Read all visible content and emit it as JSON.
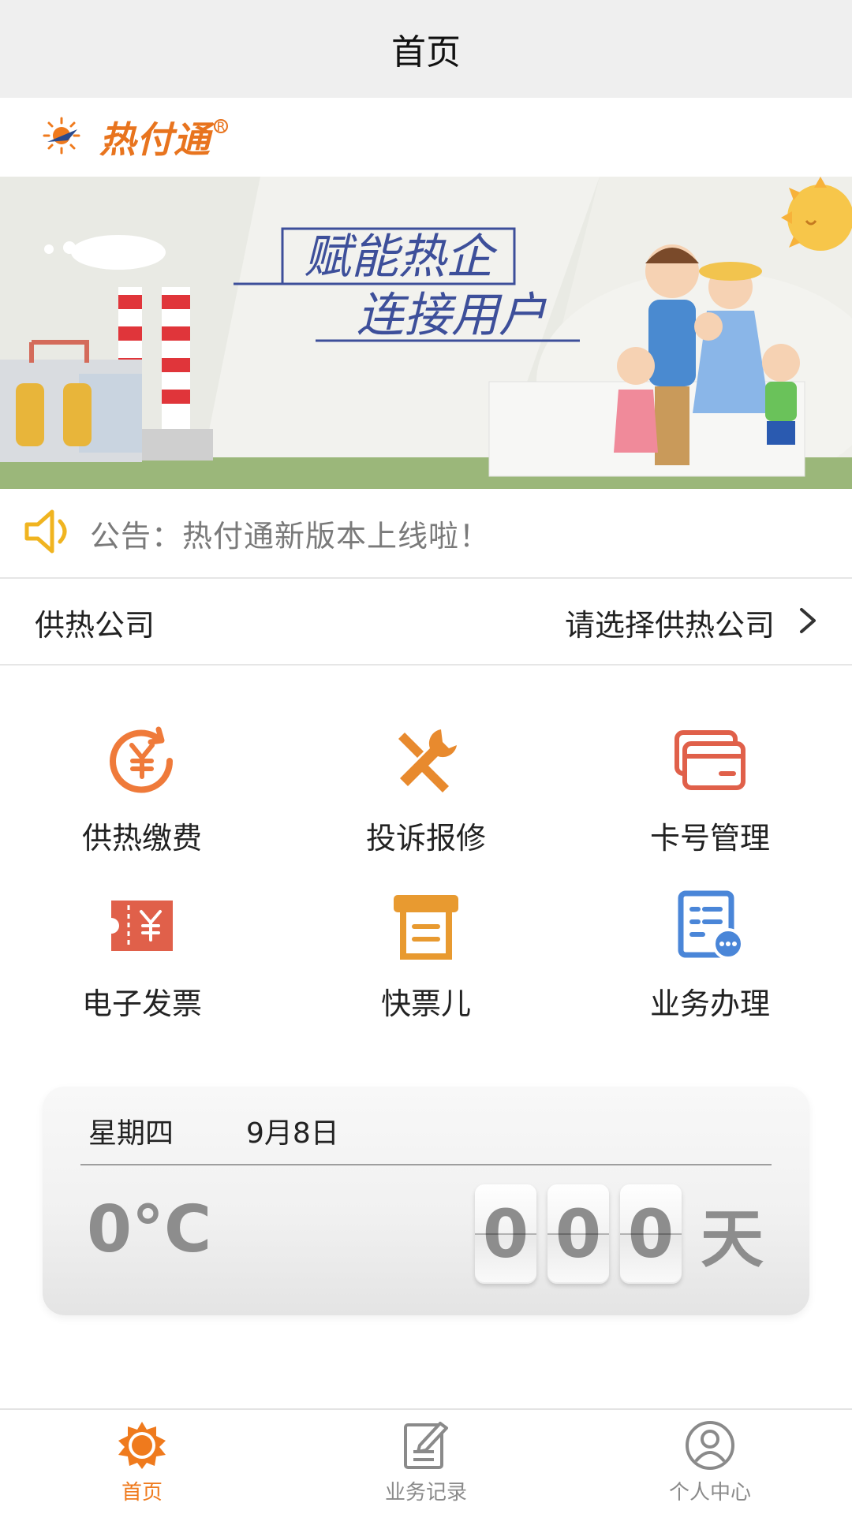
{
  "nav": {
    "title": "首页"
  },
  "logo": {
    "name": "热付通"
  },
  "banner": {
    "slogan_line1": "赋能热企",
    "slogan_line2": "连接用户"
  },
  "notice": {
    "text": "公告：热付通新版本上线啦！"
  },
  "company": {
    "label": "供热公司",
    "placeholder": "请选择供热公司"
  },
  "services": [
    {
      "label": "供热缴费",
      "icon": "yuan-refresh-icon",
      "color": "#ef7a3a"
    },
    {
      "label": "投诉报修",
      "icon": "wrench-screwdriver-icon",
      "color": "#e88a2e"
    },
    {
      "label": "卡号管理",
      "icon": "card-icon",
      "color": "#e0604a"
    },
    {
      "label": "电子发票",
      "icon": "ticket-yuan-icon",
      "color": "#e0604a"
    },
    {
      "label": "快票儿",
      "icon": "receipt-icon",
      "color": "#e89a30"
    },
    {
      "label": "业务办理",
      "icon": "document-icon",
      "color": "#4a86d8"
    }
  ],
  "weather": {
    "weekday": "星期四",
    "date": "9月8日",
    "temperature": "0°C",
    "counter_digits": [
      "0",
      "0",
      "0"
    ],
    "counter_unit": "天"
  },
  "tabs": [
    {
      "label": "首页",
      "icon": "sun-home-icon",
      "active": true
    },
    {
      "label": "业务记录",
      "icon": "edit-document-icon",
      "active": false
    },
    {
      "label": "个人中心",
      "icon": "user-icon",
      "active": false
    }
  ],
  "colors": {
    "accent": "#ef7a1d",
    "text": "#222222",
    "muted": "#8d8d8d"
  }
}
